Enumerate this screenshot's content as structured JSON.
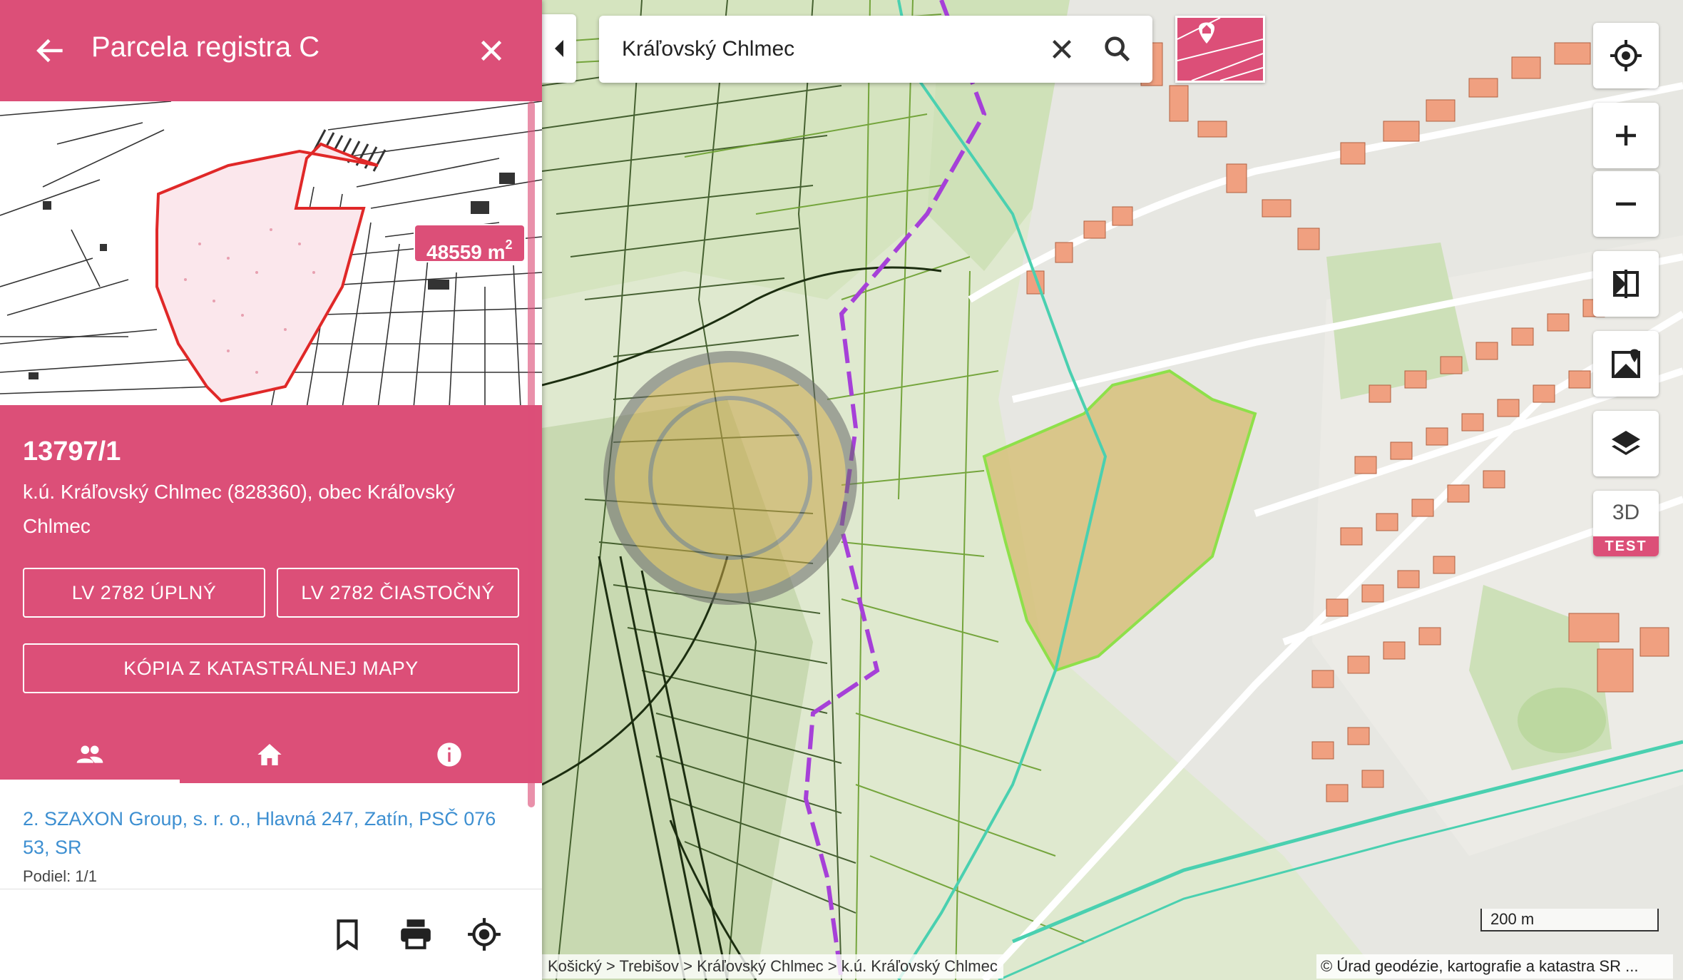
{
  "header": {
    "title": "Parcela registra C"
  },
  "parcel": {
    "area_value": "48559 m",
    "area_unit_sup": "2",
    "number": "13797/1",
    "location": "k.ú. Kráľovský Chlmec (828360), obec Kráľovský Chlmec"
  },
  "actions": {
    "lv_full": "LV 2782 ÚPLNÝ",
    "lv_partial": "LV 2782 ČIASTOČNÝ",
    "map_copy": "KÓPIA Z KATASTRÁLNEJ MAPY"
  },
  "tabs": [
    {
      "icon": "people-icon",
      "active": true
    },
    {
      "icon": "home-icon",
      "active": false
    },
    {
      "icon": "info-icon",
      "active": false
    }
  ],
  "owner": {
    "link": "2. SZAXON Group, s. r. o., Hlavná 247, Zatín, PSČ 076 53, SR",
    "share": "Podiel: 1/1"
  },
  "bottom_actions": [
    "bookmark-icon",
    "print-icon",
    "locate-parcel-icon"
  ],
  "search": {
    "value": "Kráľovský Chlmec"
  },
  "map_controls": [
    "my-location-icon",
    "zoom-in-icon",
    "zoom-out-icon",
    "compare-icon",
    "map-marker-icon",
    "layers-icon"
  ],
  "three_d": {
    "label": "3D",
    "tag": "TEST"
  },
  "map": {
    "breadcrumb": "Košický > Trebišov > Kráľovský Chlmec > k.ú. Kráľovský Chlmec",
    "copyright": "© Úrad geodézie, kartografie a katastra SR ...",
    "scale": "200 m"
  },
  "colors": {
    "accent": "#dc4f78",
    "parcel_fill": "#d6c07a",
    "parcel_outline": "#8ee04a",
    "boundary_purple": "#a640d8",
    "stream": "#4ad0b0",
    "building": "#f0a080"
  }
}
